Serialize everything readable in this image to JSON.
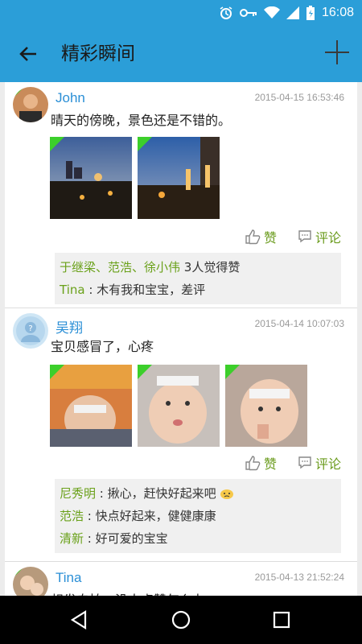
{
  "status_bar": {
    "time": "16:08",
    "icons": [
      "alarm-icon",
      "key-icon",
      "wifi-icon",
      "signal-icon",
      "battery-icon"
    ]
  },
  "app_bar": {
    "title": "精彩瞬间"
  },
  "posts": [
    {
      "name": "John",
      "time": "2015-04-15 16:53:46",
      "text": "晴天的傍晚，景色还是不错的。",
      "like_label": "赞",
      "comment_label": "评论",
      "likes_line": {
        "names": "于继梁、范浩、徐小伟",
        "suffix": " 3人觉得赞"
      },
      "comments": [
        {
          "name": "Tina",
          "sep": " : ",
          "text": "木有我和宝宝，差评"
        }
      ]
    },
    {
      "name": "吴翔",
      "time": "2015-04-14 10:07:03",
      "text": "宝贝感冒了，心疼",
      "like_label": "赞",
      "comment_label": "评论",
      "comments": [
        {
          "name": "尼秀明",
          "sep": " : ",
          "text": "揪心，赶快好起来吧"
        },
        {
          "name": "范浩",
          "sep": " : ",
          "text": "快点好起来，健健康康"
        },
        {
          "name": "清新",
          "sep": " : ",
          "text": "好可爱的宝宝"
        }
      ]
    },
    {
      "name": "Tina",
      "time": "2015-04-13 21:52:24",
      "text": "想发自拍，没人点赞怎么办"
    }
  ],
  "colors": {
    "primary": "#2b9ed8",
    "name_blue": "#2b8fd6",
    "green": "#6aa11a",
    "flag_green": "#3ccf2b"
  }
}
